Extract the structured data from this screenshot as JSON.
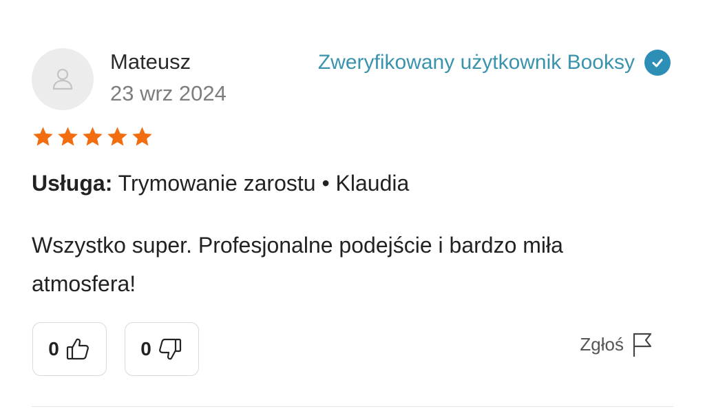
{
  "review": {
    "author": "Mateusz",
    "date": "23 wrz 2024",
    "verified_text": "Zweryfikowany użytkownik Booksy",
    "rating": 5,
    "rating_max": 5,
    "service_label": "Usługa:",
    "service_value": "Trymowanie zarostu • Klaudia",
    "text": "Wszystko super. Profesjonalne podejście i bardzo miła atmosfera!",
    "likes": "0",
    "dislikes": "0",
    "report_label": "Zgłoś"
  },
  "colors": {
    "star": "#f26d0f",
    "verified": "#3a93ad",
    "avatar_bg": "#ececec"
  },
  "icons": {
    "avatar": "user-silhouette-icon",
    "verified": "check-circle-icon",
    "like": "thumbs-up-icon",
    "dislike": "thumbs-down-icon",
    "report": "flag-icon"
  }
}
